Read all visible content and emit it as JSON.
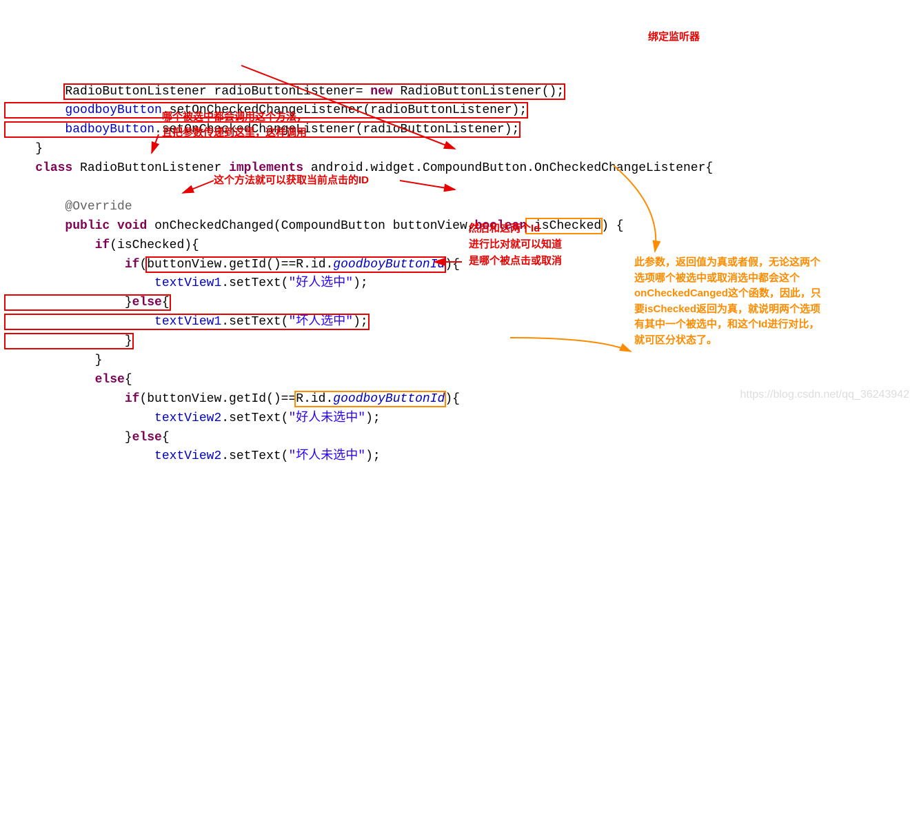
{
  "code": {
    "l1a": "RadioButtonListener radioButtonListener= ",
    "l1b": "new",
    "l1c": " RadioButtonListener();",
    "l2a": "goodboyButton",
    "l2b": ".setOnCheckedChangeListener(radioButtonListener);",
    "l3a": "badboyButton",
    "l3b": ".setOnCheckedChangeListener(radioButtonListener);",
    "l4": "    }",
    "l5a": "    ",
    "l5b": "class",
    "l5c": " RadioButtonListener ",
    "l5d": "implements",
    "l5e": " android.widget.CompoundButton.OnCheckedChangeListener{",
    "l6": "",
    "l7a": "        ",
    "l7b": "@Override",
    "l8a": "        ",
    "l8b": "public",
    "l8c": " ",
    "l8d": "void",
    "l8e": " onCheckedChanged(CompoundButton buttonView,",
    "l8f": "boolean",
    "l8g": " isChecked",
    "l8h": ") {",
    "l9a": "            ",
    "l9b": "if",
    "l9c": "(isChecked){",
    "l10a": "                ",
    "l10b": "if",
    "l10c": "(",
    "l10d": "buttonView.getId()==R.id.",
    "l10e": "goodboyButtonId",
    "l10f": "){",
    "l11a": "                    ",
    "l11b": "textView1",
    "l11c": ".setText(",
    "l11d": "\"好人选中\"",
    "l11e": ");",
    "l12a": "                }",
    "l12b": "else",
    "l12c": "{",
    "l13a": "                    ",
    "l13b": "textView1",
    "l13c": ".setText(",
    "l13d": "\"坏人选中\"",
    "l13e": ");",
    "l14": "                }",
    "l15": "            }",
    "l16a": "            ",
    "l16b": "else",
    "l16c": "{",
    "l17a": "                ",
    "l17b": "if",
    "l17c": "(buttonView.getId()==",
    "l17d": "R.id.",
    "l17e": "goodboyButtonId",
    "l17f": "){",
    "l18a": "                    ",
    "l18b": "textView2",
    "l18c": ".setText(",
    "l18d": "\"好人未选中\"",
    "l18e": ");",
    "l19a": "                }",
    "l19b": "else",
    "l19c": "{",
    "l20a": "                    ",
    "l20b": "textView2",
    "l20c": ".setText(",
    "l20d": "\"坏人未选中\"",
    "l20e": ");"
  },
  "notes": {
    "bind": "绑定监听器",
    "callnote1": "哪个被选中都会调用这个方法，",
    "callnote2": "且把参数传递到这里，这样调用",
    "getid": "这个方法就可以获取当前点击的ID",
    "cmp1": "然后和这两个Id",
    "cmp2": "进行比对就可以知道",
    "cmp3": "是哪个被点击或取消",
    "orange": "此参数，返回值为真或者假，无论这两个选项哪个被选中或取消选中都会这个onCheckedCanged这个函数，因此，只要isChecked返回为真，就说明两个选项有其中一个被选中，和这个Id进行对比，就可区分状态了。"
  },
  "watermark": "https://blog.csdn.net/qq_36243942"
}
